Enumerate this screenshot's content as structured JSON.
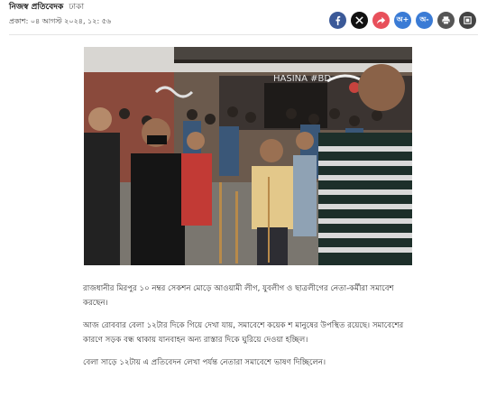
{
  "byline": {
    "author": "নিজস্ব প্রতিবেদক",
    "location": "ঢাকা"
  },
  "published": "প্রকাশ: ০৪ আগস্ট ২০২৪, ১২: ৫৬",
  "share": {
    "buttons": [
      {
        "name": "facebook-share-button",
        "icon": "facebook-icon",
        "color": "#3b5998",
        "label": "f"
      },
      {
        "name": "x-share-button",
        "icon": "x-icon",
        "color": "#111111",
        "label": "X"
      },
      {
        "name": "forward-share-button",
        "icon": "share-icon",
        "color": "#e8505b",
        "label": "➦"
      },
      {
        "name": "font-increase-button",
        "icon": "text-increase-icon",
        "color": "#3a7bd5",
        "label": "অ+"
      },
      {
        "name": "font-decrease-button",
        "icon": "text-decrease-icon",
        "color": "#3a7bd5",
        "label": "অ-"
      },
      {
        "name": "print-button",
        "icon": "print-icon",
        "color": "#555555",
        "label": "⎙"
      },
      {
        "name": "save-button",
        "icon": "bookmark-icon",
        "color": "#444444",
        "label": "▣"
      }
    ]
  },
  "photo": {
    "wall_text": "HASINA #BD"
  },
  "article": {
    "paragraphs": [
      "রাজধানীর মিরপুর ১০ নম্বর সেকশন মোড়ে আওয়ামী লীগ, যুবলীগ ও ছাত্রলীগের নেতা-কর্মীরা সমাবেশ করছেন।",
      "আজ রোববার বেলা ১২টার দিকে গিয়ে দেখা যায়, সমাবেশে কয়েক শ মানুষের উপস্থিত রয়েছে। সমাবেশের কারণে সড়ক বন্ধ থাকায় যানবাহন অন্য রাস্তার দিকে ঘুরিয়ে দেওয়া হচ্ছিল।",
      "বেলা সাড়ে ১২টায় এ প্রতিবেদন লেখা পর্যন্ত নেতারা সমাবেশে ভাষণ দিচ্ছিলেন।"
    ]
  }
}
